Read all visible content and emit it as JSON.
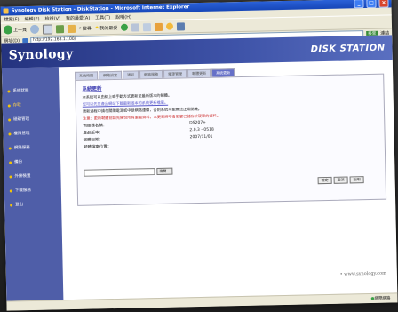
{
  "window": {
    "title": "Synology Disk Station - DiskStation - Microsoft Internet Explorer"
  },
  "menubar": {
    "items": [
      "檔案(F)",
      "編輯(E)",
      "檢視(V)",
      "我的最愛(A)",
      "工具(T)",
      "說明(H)"
    ]
  },
  "toolbar": {
    "back_label": "上一頁",
    "search_label": "搜尋",
    "favorites_label": "我的最愛",
    "go_label": "移至",
    "links_label": "連結"
  },
  "address": {
    "label": "網址(D)",
    "url": "http://192.168.1.100/"
  },
  "banner": {
    "logo": "Synology",
    "product": "DISK STATION"
  },
  "sidebar": {
    "items": [
      {
        "label": "系統狀態"
      },
      {
        "label": "存取"
      },
      {
        "label": "磁碟管理"
      },
      {
        "label": "權限管理"
      },
      {
        "label": "網路服務"
      },
      {
        "label": "備份"
      },
      {
        "label": "外接裝置"
      },
      {
        "label": "下載服務"
      },
      {
        "label": "登出"
      }
    ],
    "active_index": 1
  },
  "tabs": [
    "系統時間",
    "網路設定",
    "通知",
    "網路服務",
    "電源管理",
    "韌體更新",
    "系統更新"
  ],
  "active_tab": 6,
  "panel": {
    "title": "系統更新",
    "lines": [
      "本系統可以由線上或手動方式更新至最新版本的韌體。",
      "您可以先至產品網站下載最新版本的系統更新檔案。",
      "更新過程中請勿關閉電源或中斷網路連線，否則系統可能無法正常開機。"
    ],
    "warning": "注意：更新韌體前請先備份所有重要資料，本更新將不會影響已儲存於硬碟的資料。",
    "fields": [
      {
        "key": "伺服器名稱：",
        "value": "DS207+"
      },
      {
        "key": "產品版本：",
        "value": "2.0.3 - 0518"
      },
      {
        "key": "韌體日期：",
        "value": "2007/11/01"
      },
      {
        "key": "韌體檔案位置：",
        "value": ""
      }
    ],
    "browse_label": "瀏覽...",
    "buttons": [
      "確定",
      "取消",
      "說明"
    ]
  },
  "footer": {
    "link": "www.synology.com"
  },
  "statusbar": {
    "zone": "網際網路"
  }
}
